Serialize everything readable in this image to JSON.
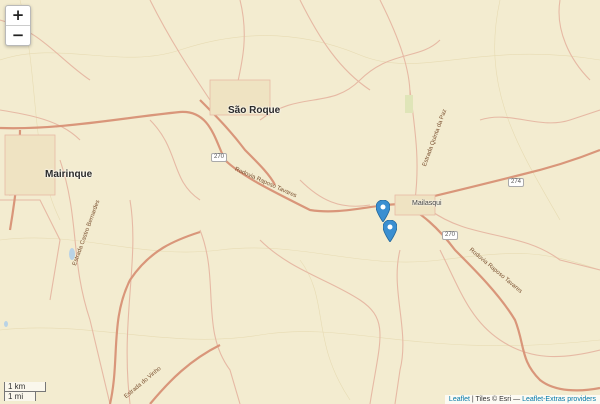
{
  "controls": {
    "zoom_in": "+",
    "zoom_out": "−"
  },
  "places": {
    "sao_roque": "São Roque",
    "mairinque": "Mairinque",
    "mailasqui": "Mailasqui"
  },
  "roads": {
    "raposo1": "Rodovia Raposo Tavares",
    "raposo2": "Rodovia Raposo Tavares",
    "sp270_a": "270",
    "sp270_b": "270",
    "sp274": "274",
    "quinta": "Estrada Quinta da Paz",
    "vinho": "Estrada do Vinho",
    "castro": "Estrada Castro Bernardes"
  },
  "scale": {
    "km": "1 km",
    "mi": "1 mi"
  },
  "attribution": {
    "leaflet": "Leaflet",
    "tiles": "| Tiles © Esri —",
    "providers": "Leaflet-Extras providers"
  },
  "colors": {
    "land": "#f3ecd0",
    "major_road": "#d9967a",
    "minor_road": "#e6b9a4",
    "marker": "#3a8fd1"
  },
  "markers": [
    {
      "name": "pin-1"
    },
    {
      "name": "pin-2"
    }
  ]
}
